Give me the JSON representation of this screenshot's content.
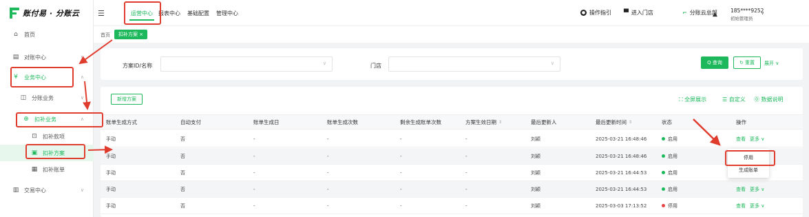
{
  "brand": {
    "name": "账付易 · 分账云"
  },
  "sidebar": {
    "items": [
      {
        "key": "home",
        "label": "首页",
        "icon": "home-icon",
        "glyph": "⌂"
      },
      {
        "key": "reconcile",
        "label": "对账中心",
        "icon": "document-icon",
        "glyph": "▤"
      },
      {
        "key": "business",
        "label": "业务中心",
        "icon": "ledger-icon",
        "glyph": "¥"
      },
      {
        "key": "split",
        "label": "分账业务",
        "icon": "split-icon",
        "glyph": "◫"
      },
      {
        "key": "deduct",
        "label": "扣补业务",
        "icon": "deduct-icon",
        "glyph": "⊕"
      },
      {
        "key": "deduct-items",
        "label": "扣补款项",
        "icon": "item-icon",
        "glyph": "⊡"
      },
      {
        "key": "deduct-plans",
        "label": "扣补方案",
        "icon": "plan-icon",
        "glyph": "▣"
      },
      {
        "key": "deduct-bills",
        "label": "扣补账单",
        "icon": "bill-icon",
        "glyph": "▦"
      },
      {
        "key": "trade",
        "label": "交易中心",
        "icon": "trade-icon",
        "glyph": "▥"
      }
    ]
  },
  "topbar": {
    "tabs": [
      "运营中心",
      "报表中心",
      "基础配置",
      "管理中心"
    ],
    "guide": "操作指引",
    "enter_store": "进入门店",
    "hq": "分账云总部",
    "user_phone": "185****9252",
    "user_role": "初始管理员"
  },
  "breadcrumb": {
    "home": "首页",
    "current": "扣补方案 ×"
  },
  "filters": {
    "plan_label": "方案ID/名称",
    "store_label": "门店",
    "query": "Q 查询",
    "reset": "↻ 重置",
    "expand": "展开 ∨"
  },
  "toolbar": {
    "new_plan": "新增方案",
    "fullscreen": "⛶ 全屏展示",
    "customize": "☰ 自定义",
    "data_help": "⓪ 数据说明"
  },
  "table": {
    "headers": [
      "账单生成方式",
      "自动支付",
      "账单生成日",
      "账单生成次数",
      "剩余生成账单次数",
      "方案生效日期",
      "最后更新人",
      "最后更新时间",
      "状态",
      "操作"
    ],
    "rows": [
      {
        "mode": "手动",
        "auto_pay": "否",
        "gen_day": "-",
        "gen_count": "-",
        "remaining": "-",
        "effective": "-",
        "updater": "刘颖",
        "updated_at": "2025-03-21 16:48:46",
        "status": "启用",
        "status_color": "#1db85b",
        "view": "查看",
        "more": "更多 ∨"
      },
      {
        "mode": "手动",
        "auto_pay": "否",
        "gen_day": "-",
        "gen_count": "-",
        "remaining": "-",
        "effective": "-",
        "updater": "刘颖",
        "updated_at": "2025-03-21 16:48:46",
        "status": "启用",
        "status_color": "#1db85b",
        "view": "",
        "more": ""
      },
      {
        "mode": "手动",
        "auto_pay": "否",
        "gen_day": "-",
        "gen_count": "-",
        "remaining": "-",
        "effective": "-",
        "updater": "刘颖",
        "updated_at": "2025-03-21 16:44:53",
        "status": "启用",
        "status_color": "#1db85b",
        "view": "",
        "more": ""
      },
      {
        "mode": "手动",
        "auto_pay": "否",
        "gen_day": "-",
        "gen_count": "-",
        "remaining": "-",
        "effective": "-",
        "updater": "刘颖",
        "updated_at": "2025-03-21 16:44:53",
        "status": "启用",
        "status_color": "#1db85b",
        "view": "查看",
        "more": "更多 ∨"
      },
      {
        "mode": "手动",
        "auto_pay": "否",
        "gen_day": "-",
        "gen_count": "-",
        "remaining": "-",
        "effective": "-",
        "updater": "刘颖",
        "updated_at": "2025-03-03 17:13:52",
        "status": "停用",
        "status_color": "#e64545",
        "view": "查看",
        "more": "更多 ∨"
      }
    ]
  },
  "dropdown": {
    "items": [
      "停用",
      "生成账单"
    ]
  },
  "colors": {
    "accent": "#1db85b",
    "highlight": "#e03c2e"
  }
}
